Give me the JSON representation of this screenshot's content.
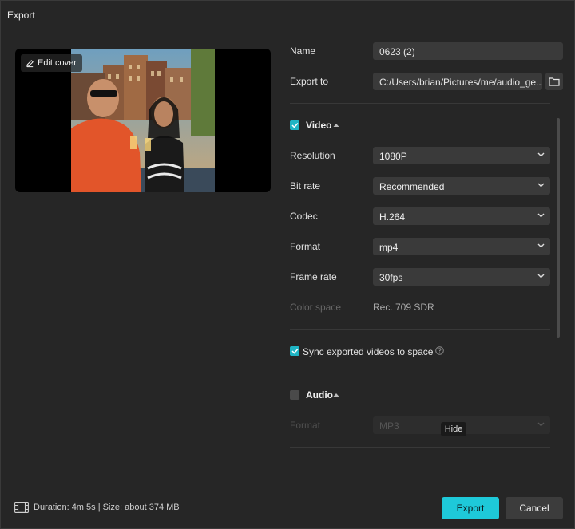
{
  "window": {
    "title": "Export"
  },
  "preview": {
    "edit_cover_label": "Edit cover"
  },
  "form": {
    "name_label": "Name",
    "name_value": "0623 (2)",
    "export_to_label": "Export to",
    "export_to_value": "C:/Users/brian/Pictures/me/audio_ge..."
  },
  "video": {
    "title": "Video",
    "checked": true,
    "resolution_label": "Resolution",
    "resolution_value": "1080P",
    "bitrate_label": "Bit rate",
    "bitrate_value": "Recommended",
    "codec_label": "Codec",
    "codec_value": "H.264",
    "format_label": "Format",
    "format_value": "mp4",
    "framerate_label": "Frame rate",
    "framerate_value": "30fps",
    "colorspace_label": "Color space",
    "colorspace_value": "Rec. 709 SDR"
  },
  "sync": {
    "label": "Sync exported videos to space",
    "checked": true
  },
  "audio": {
    "title": "Audio",
    "checked": false,
    "format_label": "Format",
    "format_value": "MP3"
  },
  "tooltip": {
    "text": "Hide"
  },
  "footer": {
    "info": "Duration: 4m 5s | Size: about 374 MB",
    "export_label": "Export",
    "cancel_label": "Cancel"
  },
  "colors": {
    "accent": "#1ec9d9",
    "checkbox": "#1fb4c4",
    "background": "#262626"
  }
}
